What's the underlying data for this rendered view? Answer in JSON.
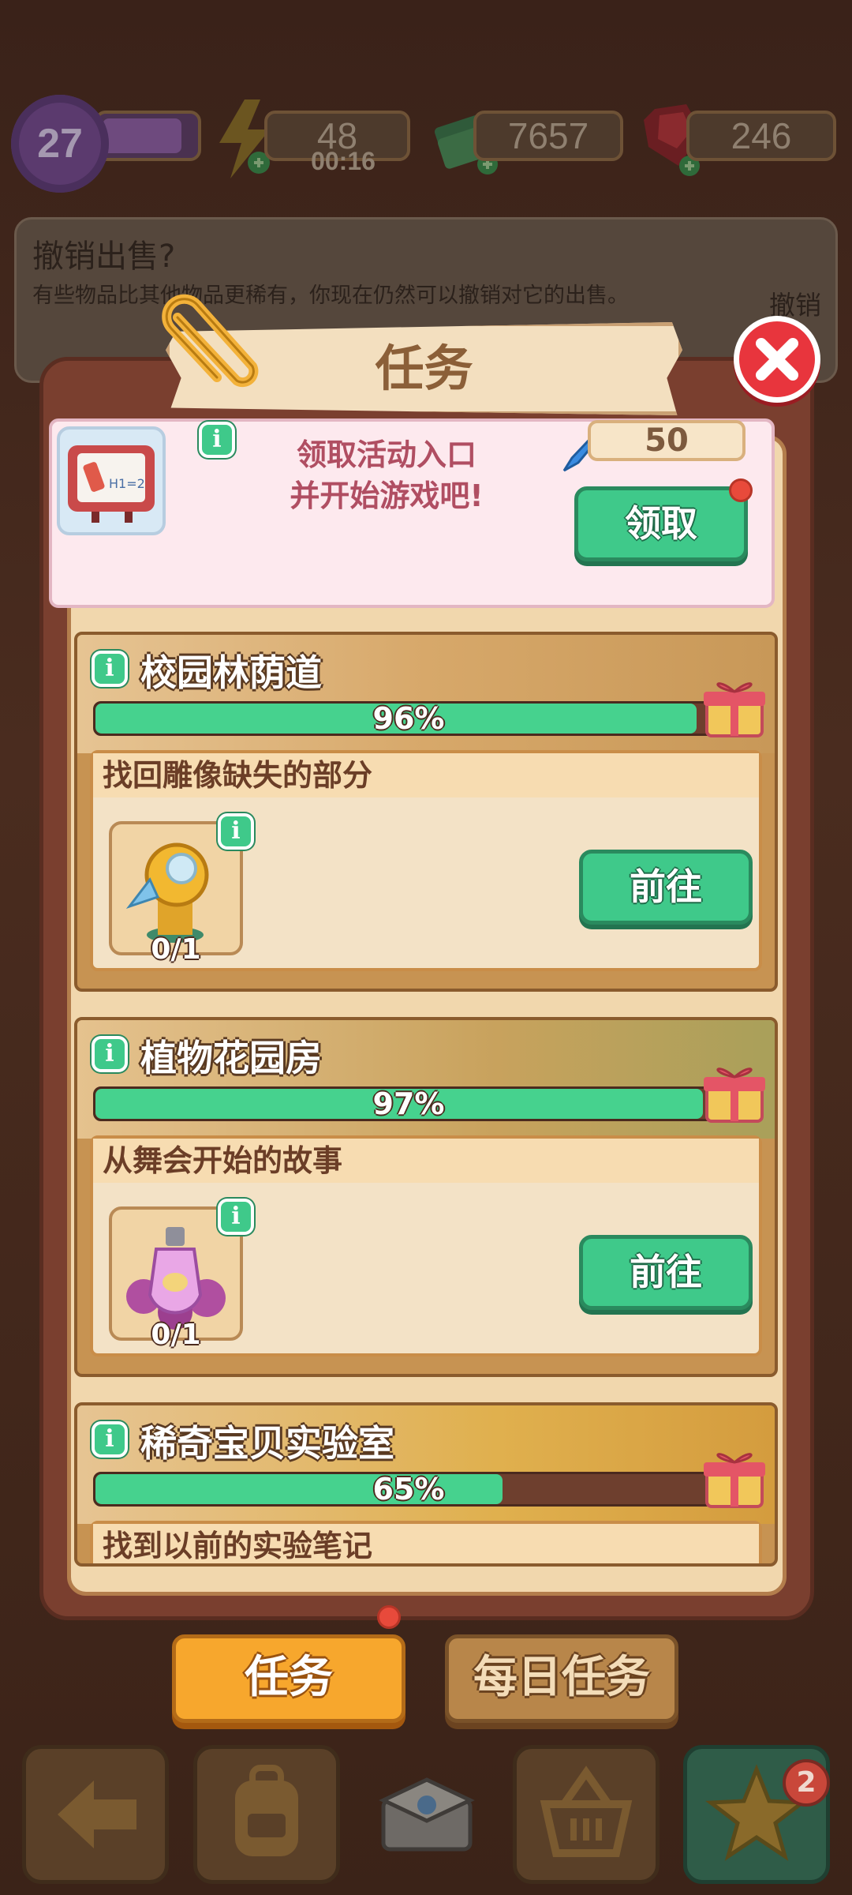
{
  "hud": {
    "level": "27",
    "energy": "48",
    "energy_timer": "00:16",
    "cash": "7657",
    "gems": "246",
    "icons": [
      "star-level-icon",
      "lightning-icon",
      "cash-stack-icon",
      "ruby-icon"
    ]
  },
  "notice": {
    "title": "撤销出售?",
    "subtitle": "有些物品比其他物品更稀有，你现在仍然可以撤销对它的出售。",
    "undo": "撤销"
  },
  "modal": {
    "title": "任务",
    "top_card": {
      "text_line1": "领取活动入口",
      "text_line2": "并开始游戏吧!",
      "reward": "50",
      "claim_button": "领取"
    },
    "areas": [
      {
        "name": "校园林荫道",
        "progress_label": "96%",
        "progress": 0.96,
        "task_title": "找回雕像缺失的部分",
        "item_count": "0/1",
        "go_button": "前往",
        "item_icon": "golden-statue-part-icon"
      },
      {
        "name": "植物花园房",
        "progress_label": "97%",
        "progress": 0.97,
        "task_title": "从舞会开始的故事",
        "item_count": "0/1",
        "go_button": "前往",
        "item_icon": "perfume-bottle-icon"
      },
      {
        "name": "稀奇宝贝实验室",
        "progress_label": "65%",
        "progress": 0.65,
        "task_title": "找到以前的实验笔记"
      }
    ]
  },
  "tabs": {
    "tasks": "任务",
    "daily": "每日任务"
  },
  "bottom_nav": {
    "badge_count": "2",
    "icons": [
      "back-arrow-icon",
      "backpack-icon",
      "treasure-box-icon",
      "basket-icon",
      "star-icon"
    ]
  },
  "colors": {
    "accent_green": "#3fc98a",
    "close_red": "#e8353d",
    "tab_orange": "#f7a72d"
  }
}
